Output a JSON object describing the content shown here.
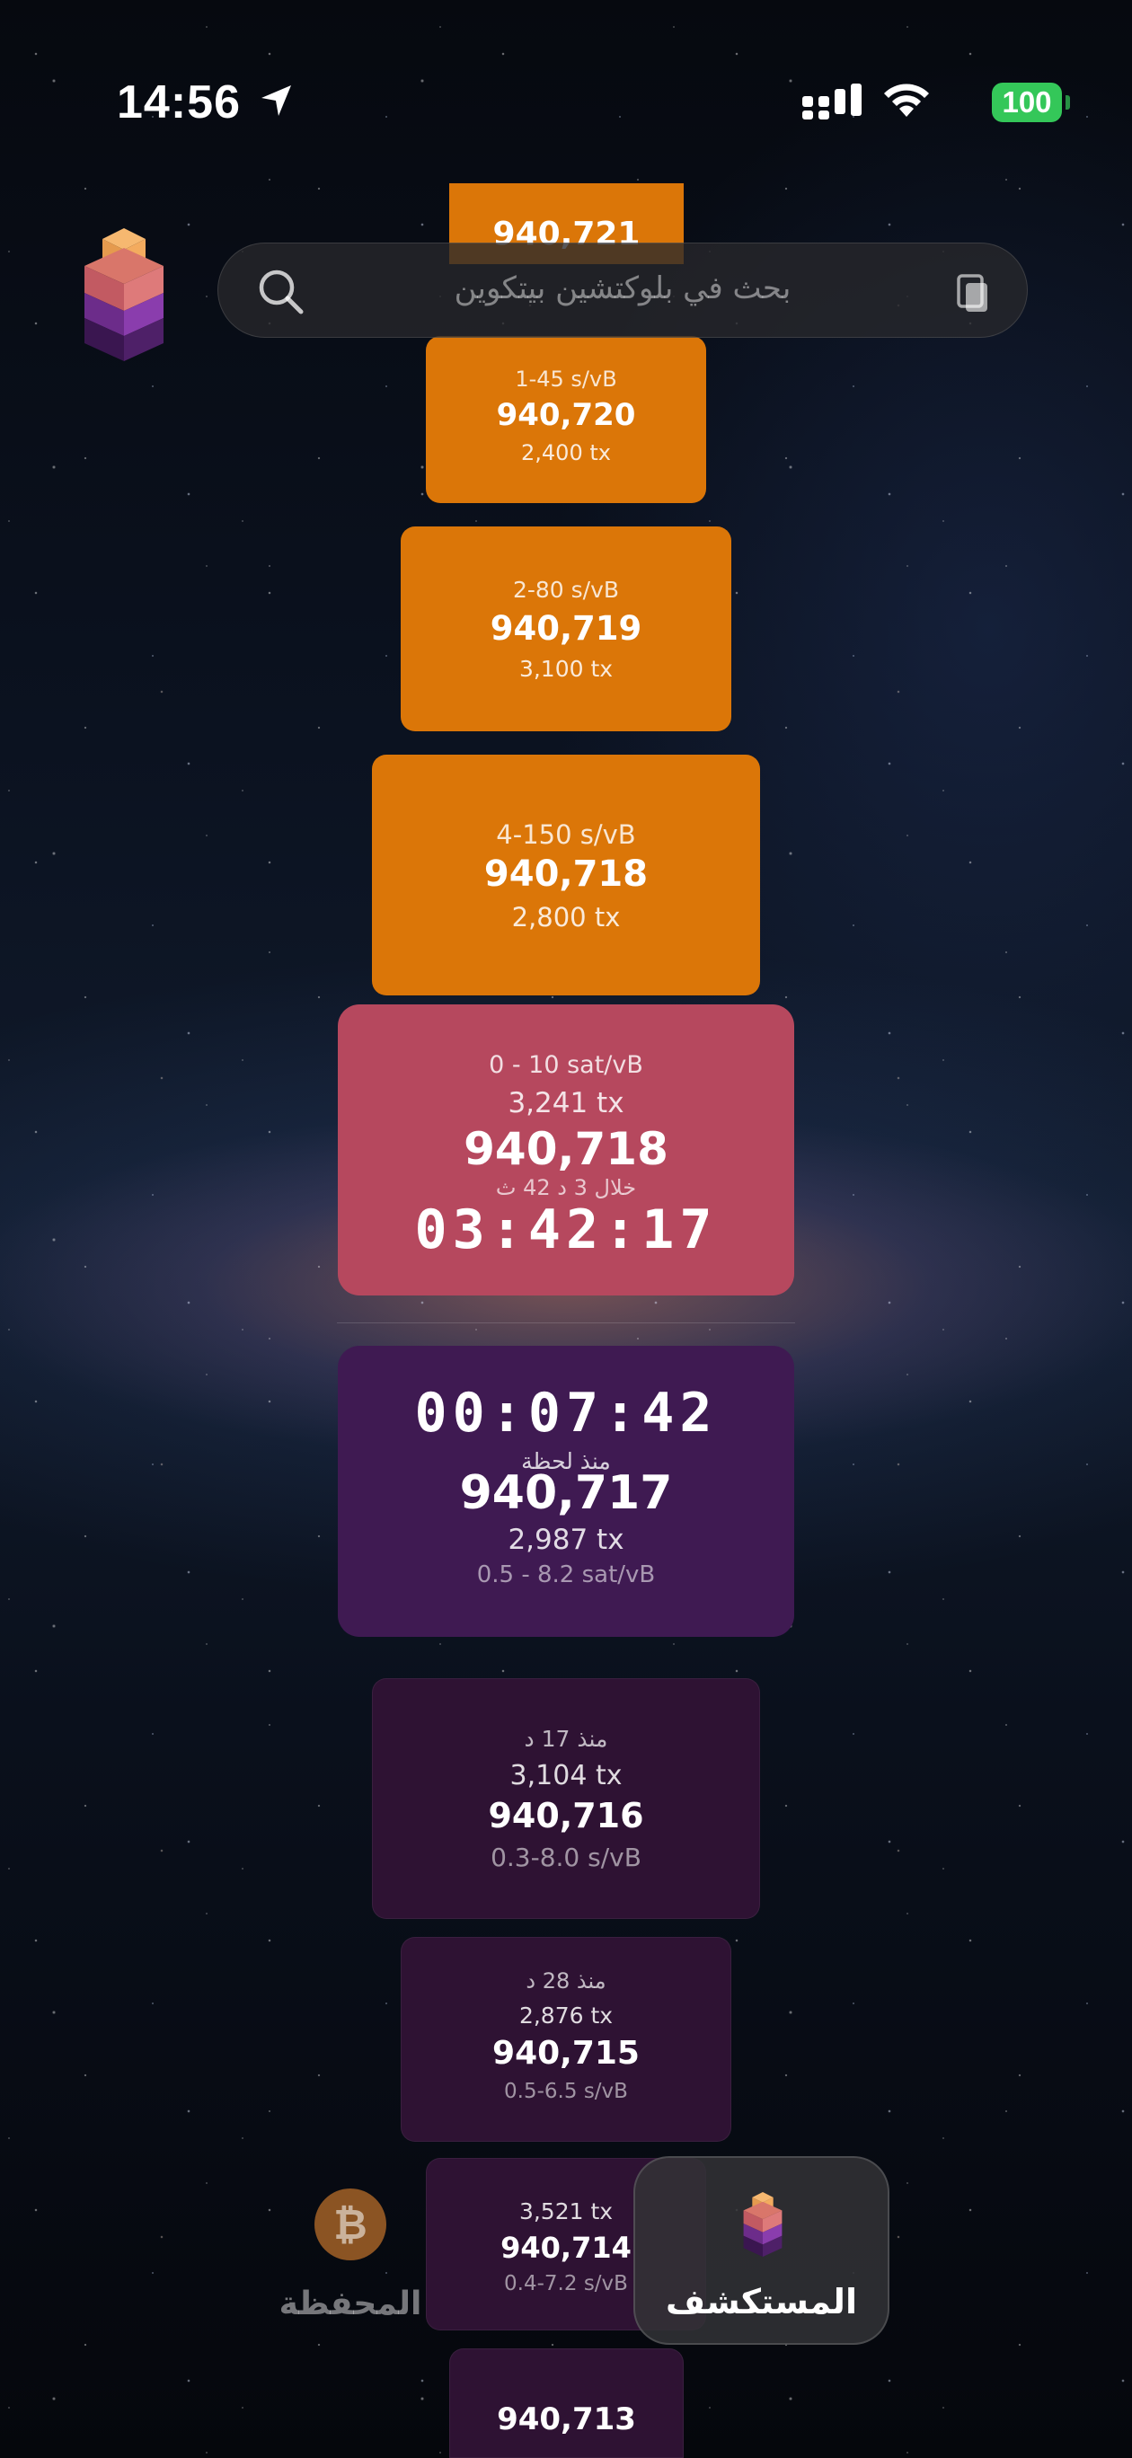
{
  "status_bar": {
    "time": "14:56",
    "battery": "100"
  },
  "search": {
    "placeholder": "بحث في بلوكتشين بيتكوين"
  },
  "upcoming_blocks": [
    {
      "fee_range": "",
      "height": "940,721",
      "tx_count": ""
    },
    {
      "fee_range": "1-45 s/vB",
      "height": "940,720",
      "tx_count": "2,400 tx"
    },
    {
      "fee_range": "2-80 s/vB",
      "height": "940,719",
      "tx_count": "3,100 tx"
    },
    {
      "fee_range": "4-150 s/vB",
      "height": "940,718",
      "tx_count": "2,800 tx"
    }
  ],
  "current_block": {
    "fee_range": "0 - 10 sat/vB",
    "tx_count": "3,241 tx",
    "height": "940,718",
    "eta_text": "خلال 3 د 42 ث",
    "countdown": "03:42:17"
  },
  "latest_block": {
    "elapsed": "00:07:42",
    "elapsed_label": "منذ لحظة",
    "height": "940,717",
    "tx_count": "2,987 tx",
    "fee_range": "0.5 - 8.2 sat/vB"
  },
  "mined_blocks": [
    {
      "age": "منذ 17 د",
      "tx_count": "3,104 tx",
      "height": "940,716",
      "fee_range": "0.3-8.0 s/vB"
    },
    {
      "age": "منذ 28 د",
      "tx_count": "2,876 tx",
      "height": "940,715",
      "fee_range": "0.5-6.5 s/vB"
    },
    {
      "age": "",
      "tx_count": "3,521 tx",
      "height": "940,714",
      "fee_range": "0.4-7.2 s/vB"
    },
    {
      "age": "",
      "tx_count": "",
      "height": "940,713",
      "fee_range": ""
    }
  ],
  "tab_bar": {
    "wallet_label": "المحفظة",
    "explorer_label": "المستكشف",
    "selected": "المستكشف"
  },
  "colors": {
    "upcoming": "#db7608",
    "current": "#b6485e",
    "latest": "#3f1a52",
    "mined": "#2e1233",
    "accent_green": "#34c759"
  },
  "icons": {
    "logo": "stacked-blocks-logo-icon",
    "search": "search-icon",
    "paste": "clipboard-paste-icon",
    "wallet": "bitcoin-icon",
    "explorer": "stacked-blocks-icon"
  }
}
